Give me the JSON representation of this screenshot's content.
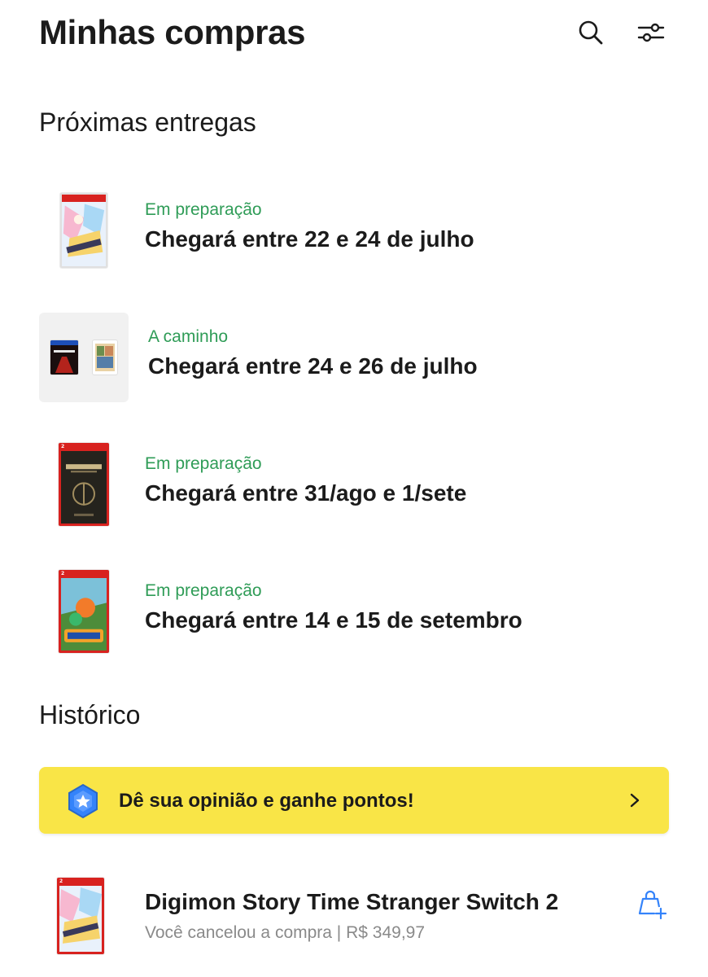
{
  "header": {
    "title": "Minhas compras",
    "icons": [
      "search-icon",
      "filter-sliders-icon"
    ]
  },
  "sections": {
    "upcoming_title": "Próximas entregas",
    "history_title": "Histórico"
  },
  "deliveries": [
    {
      "status": "Em preparação",
      "eta": "Chegará entre 22 e 24 de julho",
      "thumb": "digimon-switch-cover"
    },
    {
      "status": "A caminho",
      "eta": "Chegará entre 24 e 26 de julho",
      "thumb": "control-ps5-and-gta-covers"
    },
    {
      "status": "Em preparação",
      "eta": "Chegará entre 31/ago e 1/sete",
      "thumb": "oblivion-switch2-cover"
    },
    {
      "status": "Em preparação",
      "eta": "Chegará entre 14 e 15 de setembro",
      "thumb": "splatoon-raiders-switch2-cover"
    }
  ],
  "promo": {
    "text": "Dê sua opinião e ganhe pontos!",
    "icon": "star-hexagon-badge-icon"
  },
  "history": [
    {
      "name": "Digimon Story Time Stranger Switch 2",
      "subtitle": "Você cancelou a compra | R$ 349,97",
      "action_icon": "buy-again-bag-icon"
    }
  ],
  "colors": {
    "status_green": "#2f9c57",
    "promo_yellow": "#f9e547",
    "accent_blue": "#3483fa"
  }
}
